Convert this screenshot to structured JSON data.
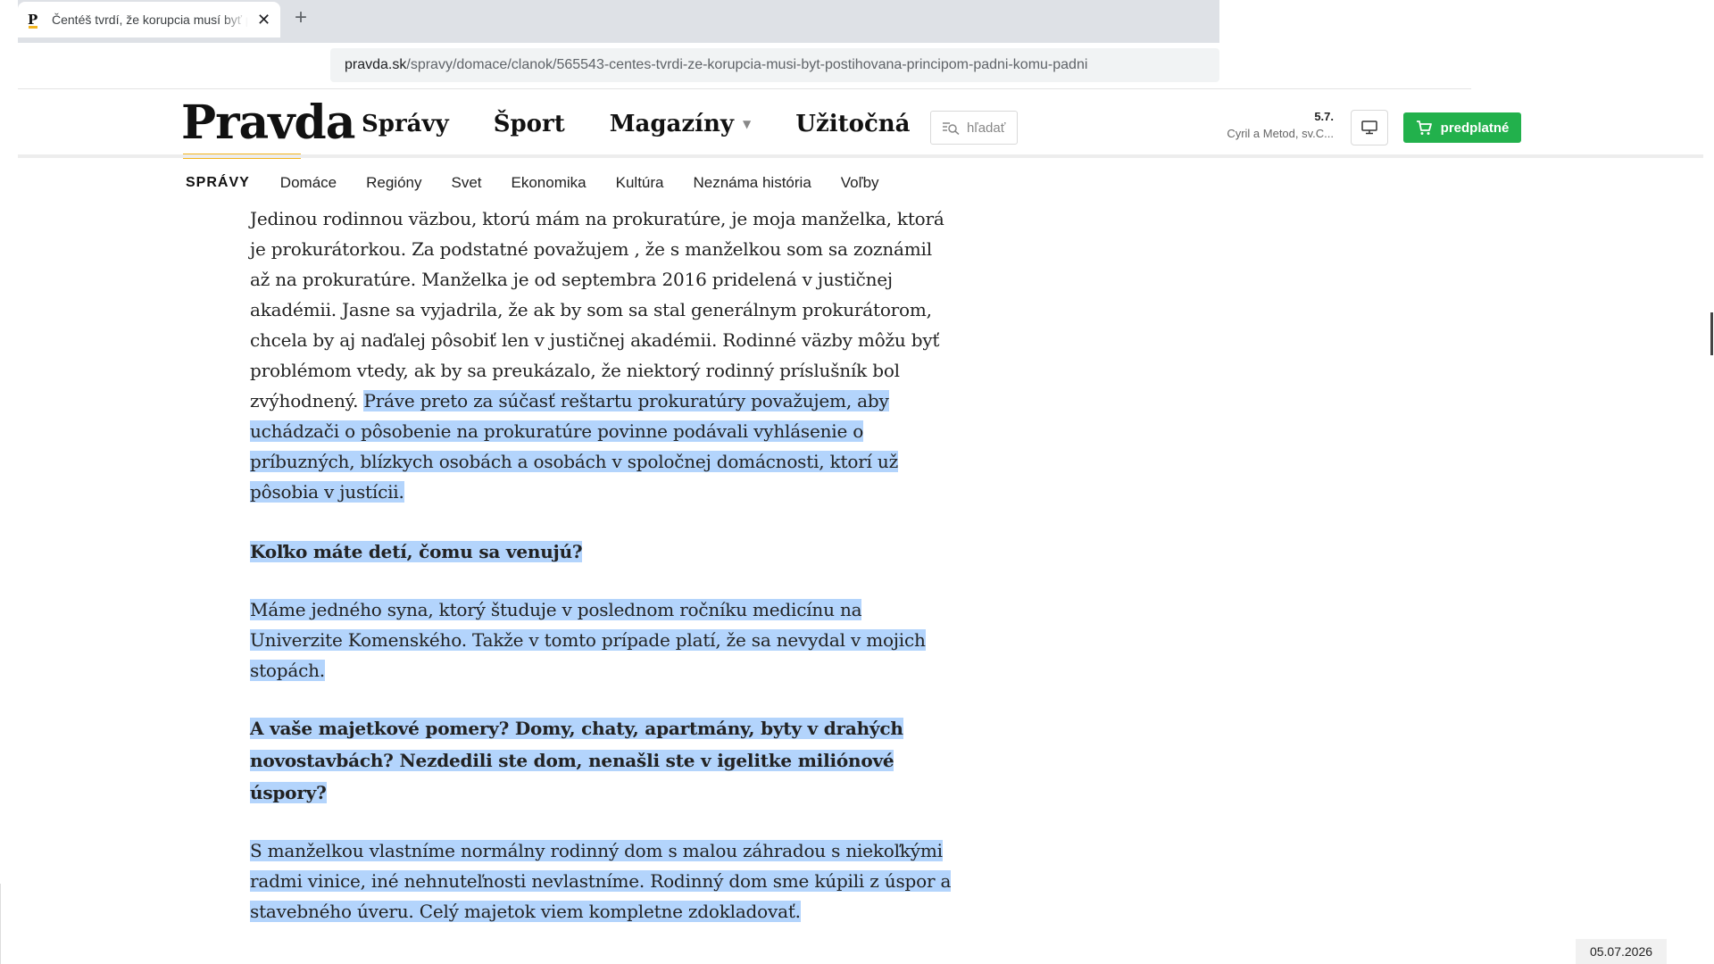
{
  "browser": {
    "tab_title": "Čentéš tvrdí, že korupcia musí byť postihovaná",
    "new_tab_symbol": "+",
    "close_symbol": "✕",
    "url_host": "pravda.sk",
    "url_path": "/spravy/domace/clanok/565543-centes-tvrdi-ze-korupcia-musi-byt-postihovana-principom-padni-komu-padni"
  },
  "header": {
    "logo": "Pravda",
    "main_nav": [
      "Správy",
      "Šport",
      "Magazíny",
      "Užitočná"
    ],
    "search_label": "hľadať",
    "nameday_date": "5.7.",
    "nameday_names": "Cyril a Metod, sv.C...",
    "subscribe_label": "predplatné"
  },
  "sub_nav": {
    "section": "SPRÁVY",
    "items": [
      "Domáce",
      "Regióny",
      "Svet",
      "Ekonomika",
      "Kultúra",
      "Neznáma história",
      "Voľby"
    ]
  },
  "article": {
    "p1_plain": "Jedinou rodinnou väzbou, ktorú mám na prokuratúre, je moja manželka, ktorá je prokurátorkou. Za podstatné považujem , že s manželkou som sa zoznámil až na prokuratúre. Manželka je od septembra 2016 pridelená v justičnej akadémii. Jasne sa vyjadrila, že ak by som sa stal generálnym prokurátorom, chcela by aj naďalej pôsobiť len v justičnej akadémii. Rodinné väzby môžu byť problémom vtedy, ak by sa preukázalo, že niektorý rodinný príslušník bol zvýhodnený.",
    "p1_selected": "Práve preto za súčasť reštartu prokuratúry považujem, aby uchádzači o pôsobenie na prokuratúre povinne podávali vyhlásenie o príbuzných, blízkych osobách a osobách v spoločnej domácnosti, ktorí už pôsobia v justícii.",
    "q1": "Koľko máte detí, čomu sa venujú?",
    "p2": "Máme jedného syna, ktorý študuje v poslednom ročníku medicínu na Univerzite Komenského. Takže v tomto prípade platí, že sa nevydal v mojich stopách.",
    "q2": "A vaše majetkové pomery? Domy, chaty, apartmány, byty v drahých novostavbách? Nezdedili ste dom, nenašli ste v igelitke miliónové úspory?",
    "p3": "S manželkou vlastníme normálny rodinný dom s malou záhradou s niekoľkými radmi vinice, iné nehnuteľnosti nevlastníme. Rodinný dom sme kúpili z úspor a stavebného úveru. Celý majetok viem kompletne zdokladovať."
  },
  "footer": {
    "date": "05.07.2026"
  },
  "colors": {
    "accent_yellow": "#f2b41e",
    "subscribe_green": "#22b14c",
    "selection": "#b3d4fc"
  }
}
